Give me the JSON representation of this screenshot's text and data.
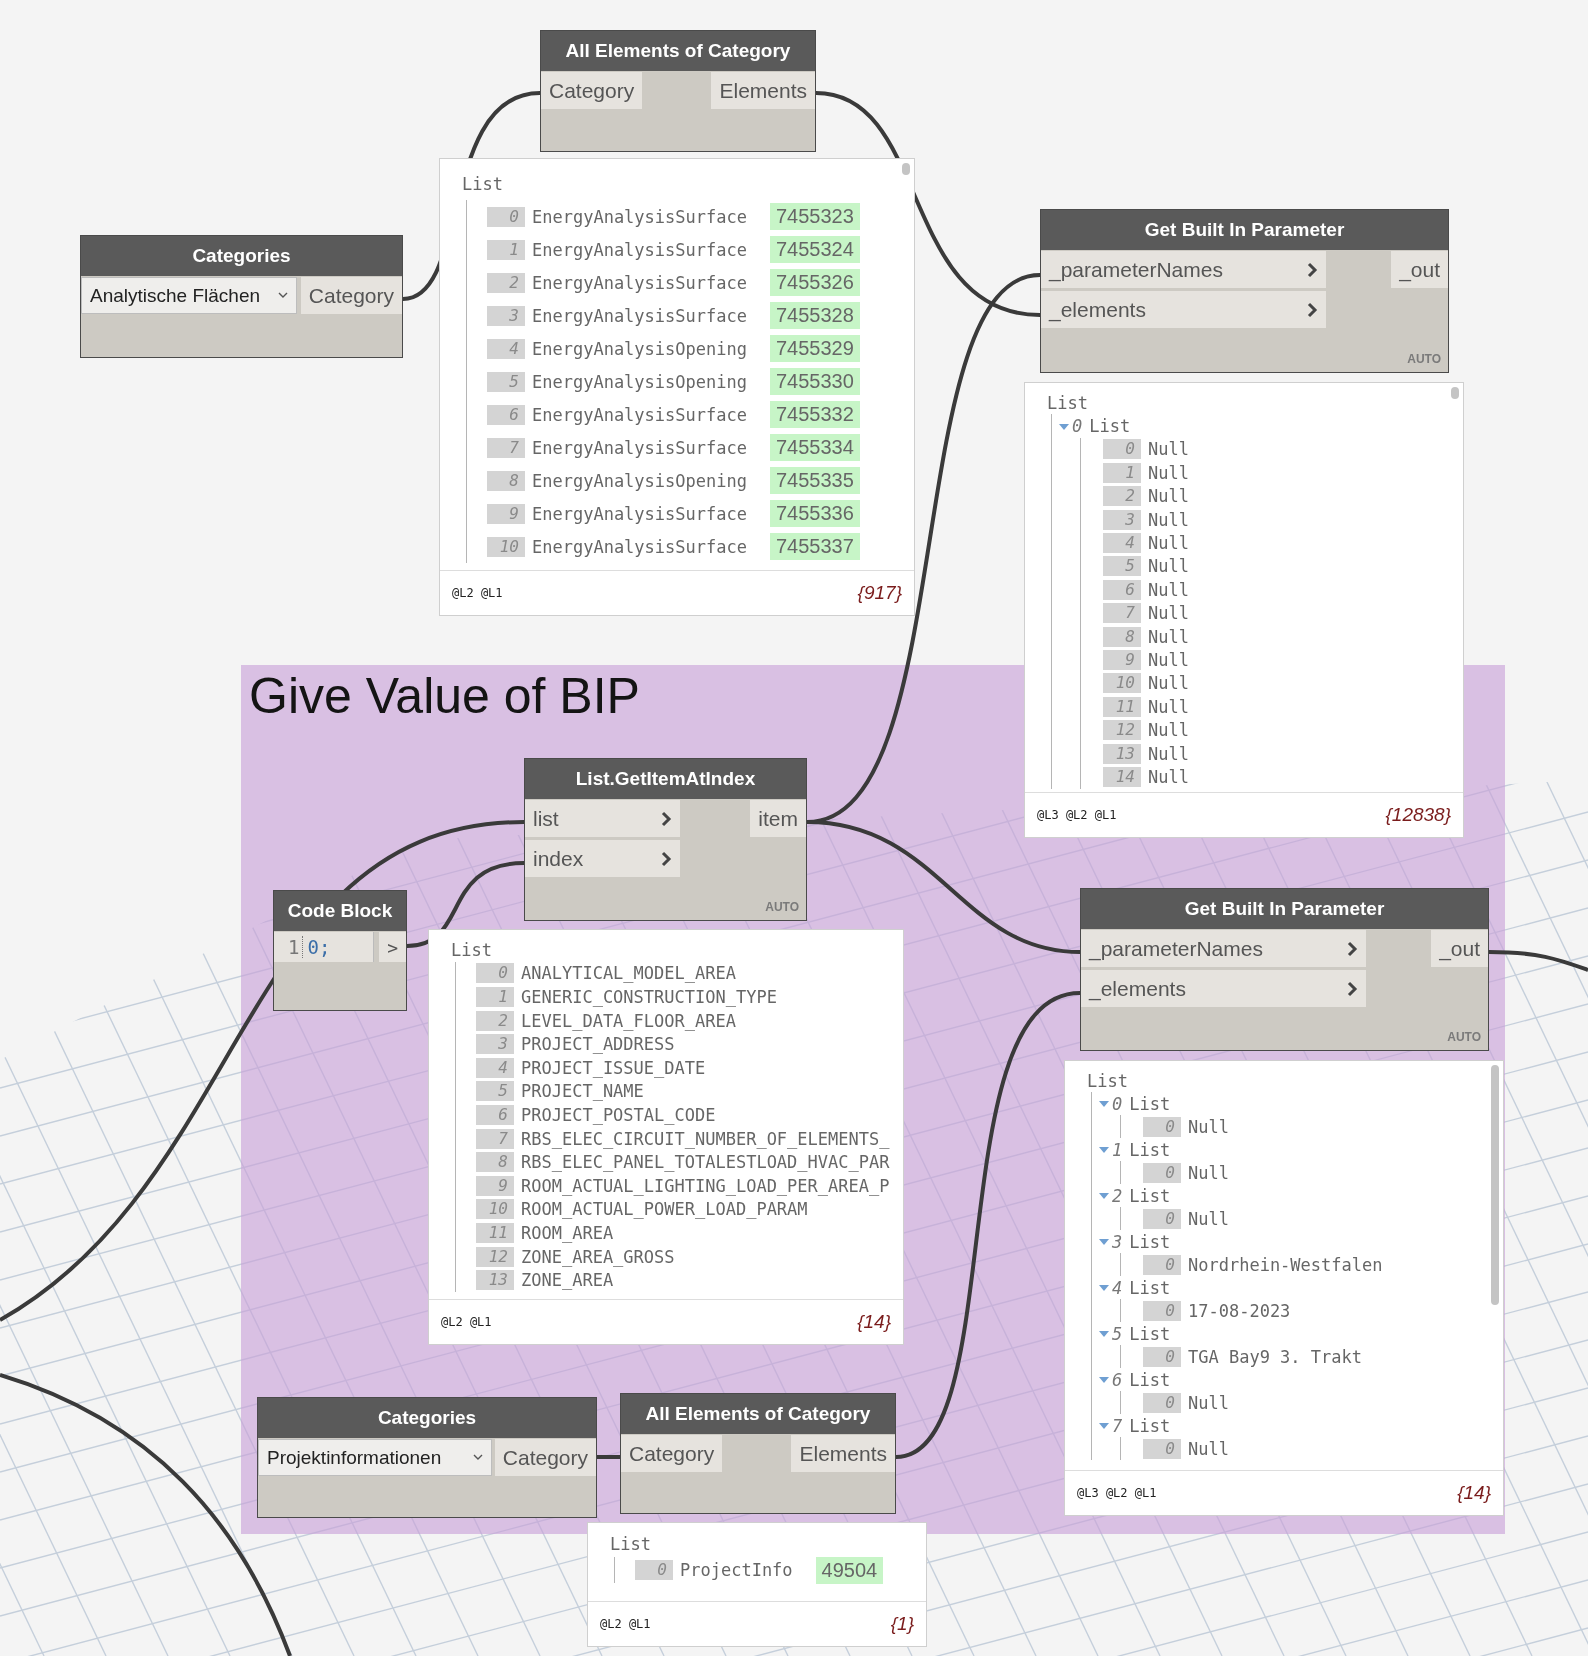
{
  "canvas": {
    "group": {
      "title": "Give Value of BIP"
    },
    "nodes": [
      {
        "kind": "all_elements",
        "title": "All Elements of Category",
        "inputs": [
          {
            "label": "Category"
          }
        ],
        "outputs": [
          {
            "label": "Elements"
          }
        ]
      },
      {
        "kind": "categories",
        "title": "Categories",
        "dropdown": "Analytische Flächen",
        "outputs": [
          {
            "label": "Category"
          }
        ]
      },
      {
        "kind": "get_bip",
        "title": "Get Built In Parameter",
        "inputs": [
          {
            "label": "_parameterNames"
          },
          {
            "label": "_elements"
          }
        ],
        "outputs": [
          {
            "label": "_out"
          }
        ],
        "lacing": "AUTO"
      },
      {
        "kind": "get_item",
        "title": "List.GetItemAtIndex",
        "inputs": [
          {
            "label": "list"
          },
          {
            "label": "index"
          }
        ],
        "outputs": [
          {
            "label": "item"
          }
        ],
        "lacing": "AUTO"
      },
      {
        "kind": "code_block",
        "title": "Code Block",
        "line_number": "1",
        "code": "0;",
        "outputs": [
          {
            "label": ">"
          }
        ]
      },
      {
        "kind": "get_bip",
        "title": "Get Built In Parameter",
        "inputs": [
          {
            "label": "_parameterNames"
          },
          {
            "label": "_elements"
          }
        ],
        "outputs": [
          {
            "label": "_out"
          }
        ],
        "lacing": "AUTO"
      },
      {
        "kind": "categories",
        "title": "Categories",
        "dropdown": "Projektinformationen",
        "outputs": [
          {
            "label": "Category"
          }
        ]
      },
      {
        "kind": "all_elements",
        "title": "All Elements of Category",
        "inputs": [
          {
            "label": "Category"
          }
        ],
        "outputs": [
          {
            "label": "Elements"
          }
        ]
      }
    ],
    "watches": [
      {
        "root": "List",
        "items": [
          {
            "index": "0",
            "text": "EnergyAnalysisSurface",
            "id": "7455323"
          },
          {
            "index": "1",
            "text": "EnergyAnalysisSurface",
            "id": "7455324"
          },
          {
            "index": "2",
            "text": "EnergyAnalysisSurface",
            "id": "7455326"
          },
          {
            "index": "3",
            "text": "EnergyAnalysisSurface",
            "id": "7455328"
          },
          {
            "index": "4",
            "text": "EnergyAnalysisOpening",
            "id": "7455329"
          },
          {
            "index": "5",
            "text": "EnergyAnalysisOpening",
            "id": "7455330"
          },
          {
            "index": "6",
            "text": "EnergyAnalysisSurface",
            "id": "7455332"
          },
          {
            "index": "7",
            "text": "EnergyAnalysisSurface",
            "id": "7455334"
          },
          {
            "index": "8",
            "text": "EnergyAnalysisOpening",
            "id": "7455335"
          },
          {
            "index": "9",
            "text": "EnergyAnalysisSurface",
            "id": "7455336"
          },
          {
            "index": "10",
            "text": "EnergyAnalysisSurface",
            "id": "7455337"
          }
        ],
        "levels": "@L2 @L1",
        "count": "{917}"
      },
      {
        "root": "List",
        "items": [
          {
            "index": "0",
            "text": "List",
            "expanded": true,
            "children": [
              {
                "index": "0",
                "text": "Null"
              },
              {
                "index": "1",
                "text": "Null"
              },
              {
                "index": "2",
                "text": "Null"
              },
              {
                "index": "3",
                "text": "Null"
              },
              {
                "index": "4",
                "text": "Null"
              },
              {
                "index": "5",
                "text": "Null"
              },
              {
                "index": "6",
                "text": "Null"
              },
              {
                "index": "7",
                "text": "Null"
              },
              {
                "index": "8",
                "text": "Null"
              },
              {
                "index": "9",
                "text": "Null"
              },
              {
                "index": "10",
                "text": "Null"
              },
              {
                "index": "11",
                "text": "Null"
              },
              {
                "index": "12",
                "text": "Null"
              },
              {
                "index": "13",
                "text": "Null"
              },
              {
                "index": "14",
                "text": "Null"
              }
            ]
          }
        ],
        "levels": "@L3 @L2 @L1",
        "count": "{12838}"
      },
      {
        "root": "List",
        "items": [
          {
            "index": "0",
            "text": "ANALYTICAL_MODEL_AREA"
          },
          {
            "index": "1",
            "text": "GENERIC_CONSTRUCTION_TYPE"
          },
          {
            "index": "2",
            "text": "LEVEL_DATA_FLOOR_AREA"
          },
          {
            "index": "3",
            "text": "PROJECT_ADDRESS"
          },
          {
            "index": "4",
            "text": "PROJECT_ISSUE_DATE"
          },
          {
            "index": "5",
            "text": "PROJECT_NAME"
          },
          {
            "index": "6",
            "text": "PROJECT_POSTAL_CODE"
          },
          {
            "index": "7",
            "text": "RBS_ELEC_CIRCUIT_NUMBER_OF_ELEMENTS_"
          },
          {
            "index": "8",
            "text": "RBS_ELEC_PANEL_TOTALESTLOAD_HVAC_PAR"
          },
          {
            "index": "9",
            "text": "ROOM_ACTUAL_LIGHTING_LOAD_PER_AREA_P"
          },
          {
            "index": "10",
            "text": "ROOM_ACTUAL_POWER_LOAD_PARAM"
          },
          {
            "index": "11",
            "text": "ROOM_AREA"
          },
          {
            "index": "12",
            "text": "ZONE_AREA_GROSS"
          },
          {
            "index": "13",
            "text": "ZONE_AREA"
          }
        ],
        "levels": "@L2 @L1",
        "count": "{14}"
      },
      {
        "root": "List",
        "items": [
          {
            "index": "0",
            "text": "List",
            "expanded": true,
            "children": [
              {
                "index": "0",
                "text": "Null"
              }
            ]
          },
          {
            "index": "1",
            "text": "List",
            "expanded": true,
            "children": [
              {
                "index": "0",
                "text": "Null"
              }
            ]
          },
          {
            "index": "2",
            "text": "List",
            "expanded": true,
            "children": [
              {
                "index": "0",
                "text": "Null"
              }
            ]
          },
          {
            "index": "3",
            "text": "List",
            "expanded": true,
            "children": [
              {
                "index": "0",
                "text": "Nordrhein-Westfalen"
              }
            ]
          },
          {
            "index": "4",
            "text": "List",
            "expanded": true,
            "children": [
              {
                "index": "0",
                "text": "17-08-2023"
              }
            ]
          },
          {
            "index": "5",
            "text": "List",
            "expanded": true,
            "children": [
              {
                "index": "0",
                "text": "TGA Bay9 3. Trakt"
              }
            ]
          },
          {
            "index": "6",
            "text": "List",
            "expanded": true,
            "children": [
              {
                "index": "0",
                "text": "Null"
              }
            ]
          },
          {
            "index": "7",
            "text": "List",
            "expanded": true,
            "children": [
              {
                "index": "0",
                "text": "Null"
              }
            ]
          }
        ],
        "levels": "@L3 @L2 @L1",
        "count": "{14}"
      },
      {
        "root": "List",
        "items": [
          {
            "index": "0",
            "text": "ProjectInfo",
            "id": "49504"
          }
        ],
        "levels": "@L2 @L1",
        "count": "{1}"
      }
    ]
  }
}
